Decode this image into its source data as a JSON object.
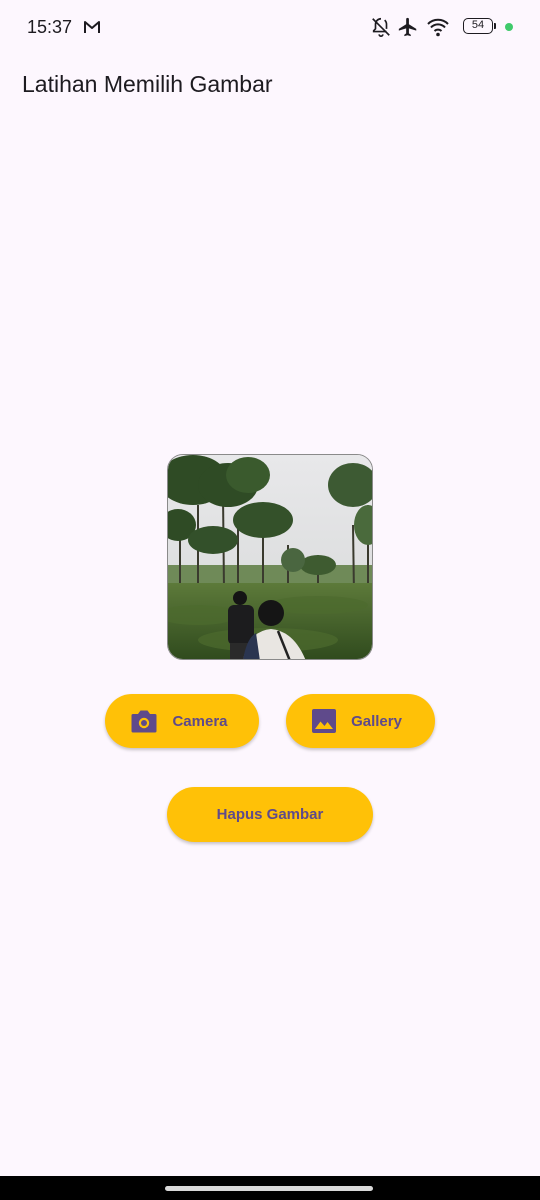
{
  "status_bar": {
    "time": "15:37",
    "battery_level": "54",
    "icons": [
      "gmail-icon",
      "notifications-off-icon",
      "airplane-mode-icon",
      "wifi-icon",
      "battery-icon",
      "privacy-indicator-dot"
    ]
  },
  "app_bar": {
    "title": "Latihan Memilih Gambar"
  },
  "image_preview": {
    "icon": "selected-photo"
  },
  "buttons": {
    "camera_label": "Camera",
    "gallery_label": "Gallery",
    "hapus_label": "Hapus Gambar"
  },
  "colors": {
    "background": "#fdf7fe",
    "button": "#ffc107",
    "button_text": "#5f4a8b"
  }
}
